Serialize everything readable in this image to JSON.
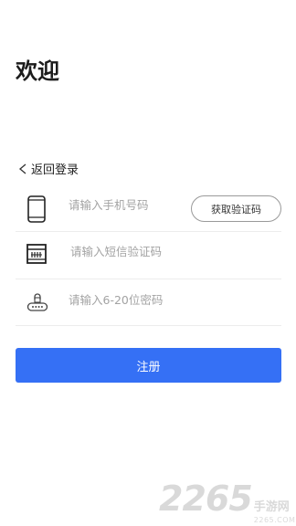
{
  "header": {
    "title": "欢迎"
  },
  "back": {
    "label": "返回登录"
  },
  "form": {
    "phone": {
      "placeholder": "请输入手机号码",
      "value": ""
    },
    "get_code_label": "获取验证码",
    "sms_code": {
      "placeholder": "请输入短信验证码",
      "value": ""
    },
    "password": {
      "placeholder": "请输入6-20位密码",
      "value": ""
    }
  },
  "actions": {
    "register_label": "注册"
  },
  "watermark": {
    "brand": "2265",
    "site": "手游网",
    "domain": "2265.COM"
  },
  "icons": {
    "back": "chevron-left-icon",
    "phone": "phone-icon",
    "sms": "sms-code-icon",
    "password": "lock-icon"
  },
  "colors": {
    "accent": "#3570f5",
    "placeholder": "#a3a3a3"
  }
}
